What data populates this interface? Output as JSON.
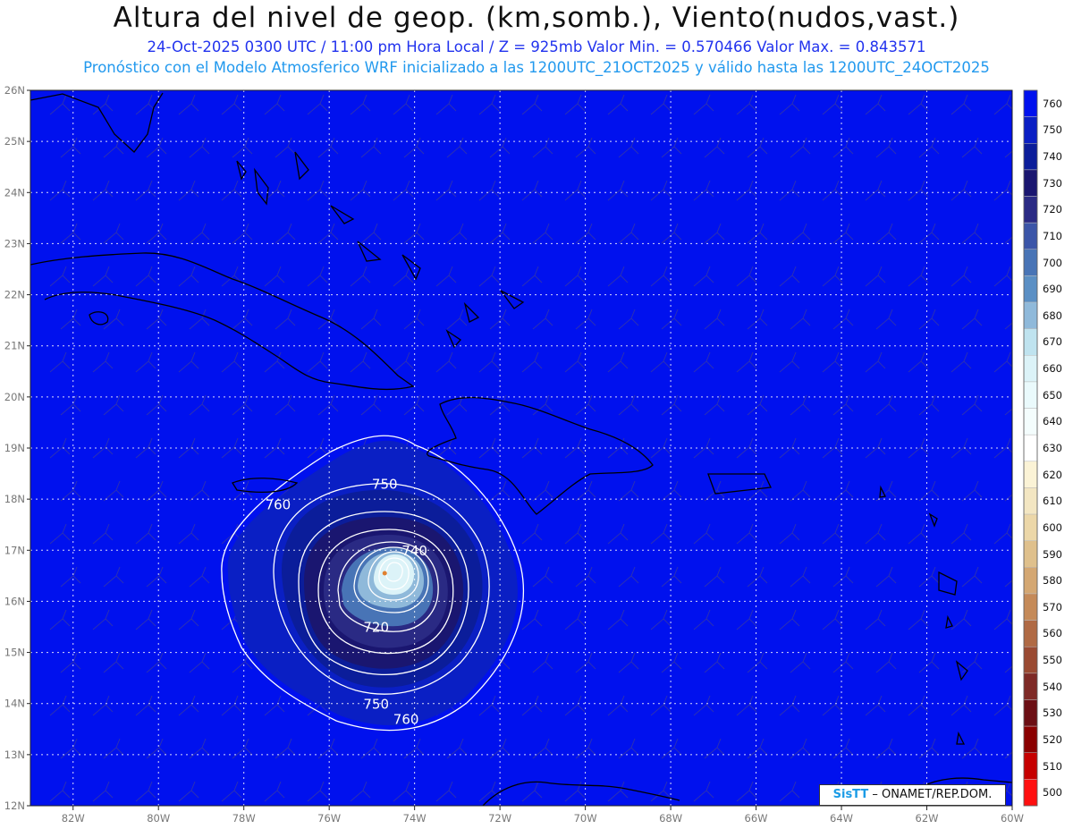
{
  "header": {
    "title": "Altura del nivel de geop. (km,somb.), Viento(nudos,vast.)",
    "subtitle": "24-Oct-2025  0300 UTC / 11:00 pm Hora Local / Z = 925mb  Valor Min. = 0.570466  Valor Max. = 0.843571",
    "model_line": "Pronóstico con el Modelo Atmosferico WRF inicializado a las 1200UTC_21OCT2025 y válido hasta las  1200UTC_24OCT2025"
  },
  "map": {
    "lon_range": [
      -83,
      -60
    ],
    "lat_range": [
      12,
      26
    ],
    "lon_ticks": [
      "82W",
      "80W",
      "78W",
      "76W",
      "74W",
      "72W",
      "70W",
      "68W",
      "66W",
      "64W",
      "62W",
      "60W"
    ],
    "lat_ticks": [
      "12N",
      "13N",
      "14N",
      "15N",
      "16N",
      "17N",
      "18N",
      "19N",
      "20N",
      "21N",
      "22N",
      "23N",
      "24N",
      "25N",
      "26N"
    ],
    "contour_labels": [
      {
        "text": "760",
        "lon": -77.2,
        "lat": 17.8
      },
      {
        "text": "750",
        "lon": -74.7,
        "lat": 18.2
      },
      {
        "text": "740",
        "lon": -74.0,
        "lat": 16.9
      },
      {
        "text": "720",
        "lon": -74.9,
        "lat": 15.4
      },
      {
        "text": "750",
        "lon": -74.9,
        "lat": 13.9
      },
      {
        "text": "760",
        "lon": -74.2,
        "lat": 13.6
      }
    ],
    "storm_center": {
      "lon": -74.7,
      "lat": 16.55
    },
    "background_color": "#0011ee"
  },
  "colorbar": {
    "levels": [
      "760",
      "750",
      "740",
      "730",
      "720",
      "710",
      "700",
      "690",
      "680",
      "670",
      "660",
      "650",
      "640",
      "630",
      "620",
      "610",
      "600",
      "590",
      "580",
      "570",
      "560",
      "550",
      "540",
      "530",
      "520",
      "510",
      "500"
    ],
    "colors": [
      "#0011ee",
      "#0a1fc4",
      "#0b1d9a",
      "#1a1670",
      "#2a2a84",
      "#3b55a8",
      "#4874b6",
      "#5a8fc4",
      "#8fb9da",
      "#bfe3ef",
      "#dcf3f8",
      "#eafafc",
      "#f4fdfd",
      "#ffffff",
      "#fbf3d6",
      "#f3e6c2",
      "#ecd7a8",
      "#dfc08c",
      "#d4a772",
      "#c58a58",
      "#b06a44",
      "#9a4a32",
      "#7e2a26",
      "#6c0f14",
      "#8a0000",
      "#c60000",
      "#ff1010"
    ]
  },
  "credit": {
    "brand": "SisTT",
    "text": " – ONAMET/REP.DOM."
  }
}
